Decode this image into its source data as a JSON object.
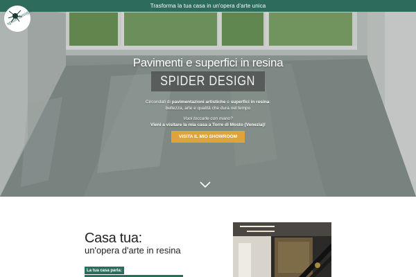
{
  "topbar": {
    "text": "Trasforma la tua casa in un'opera d'arte unica"
  },
  "logo": {
    "text": "spiderdesign"
  },
  "hero": {
    "title": "Pavimenti e superfici in resina",
    "brand": "SPIDER DESIGN",
    "copy1_prefix": "Circondati di ",
    "copy1_bold1": "pavimentazioni artistiche",
    "copy1_mid": " e ",
    "copy1_bold2": "superfici in resina",
    "copy1_suffix": ":",
    "copy1_line2": "bellezza, arte e qualità che dura nel tempo",
    "copy2_italic": "Vuoi toccarle con mano?",
    "copy2_bold": "Vieni a visitare la mia casa a Torre di Mosto (Venezia)!",
    "cta_label": "VISITA IL MIO SHOWROOM"
  },
  "section": {
    "title": "Casa tua:",
    "subtitle": "un'opera d'arte in resina",
    "label": "La tua casa parla:"
  },
  "colors": {
    "brand_green": "#2d6b5c",
    "cta_orange": "#e0a33a"
  },
  "icons": {
    "scroll": "chevron-down-icon",
    "logo": "spider-logo-icon"
  }
}
